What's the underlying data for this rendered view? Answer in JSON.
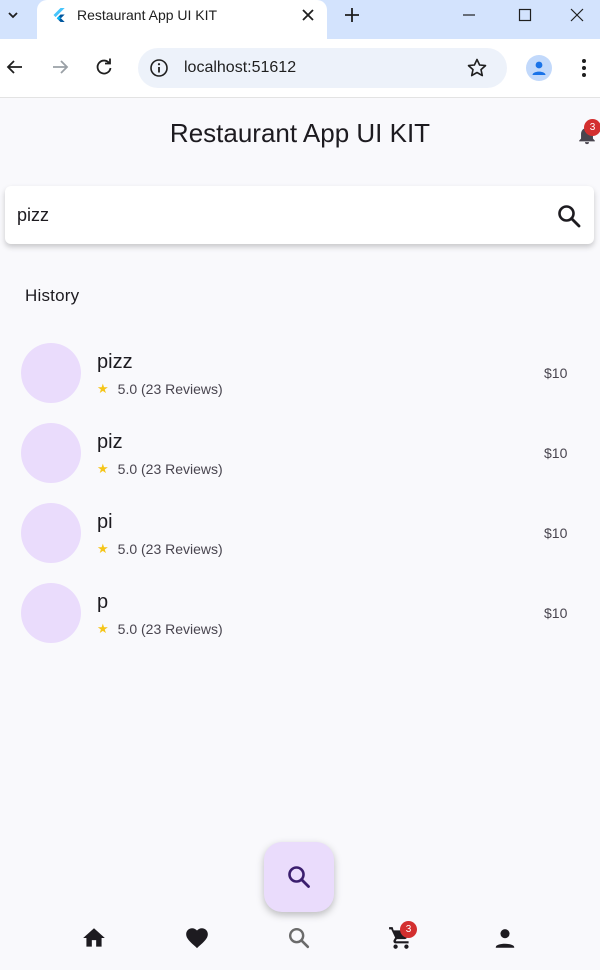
{
  "browser": {
    "tab_title": "Restaurant App UI KIT",
    "url": "localhost:51612",
    "icons": [
      "tab-list-icon",
      "flutter-icon",
      "close-icon",
      "plus-icon",
      "minimize-icon",
      "maximize-icon",
      "window-close-icon",
      "back-icon",
      "forward-icon",
      "reload-icon",
      "site-info-icon",
      "bookmark-star-icon",
      "profile-icon",
      "kebab-menu-icon"
    ]
  },
  "app": {
    "title": "Restaurant App UI KIT",
    "notification_count": "3",
    "search": {
      "value": "pizz"
    },
    "history_title": "History",
    "history": [
      {
        "name": "pizz",
        "rating": "5.0 (23 Reviews)",
        "price": "$10"
      },
      {
        "name": "piz",
        "rating": "5.0 (23 Reviews)",
        "price": "$10"
      },
      {
        "name": "pi",
        "rating": "5.0 (23 Reviews)",
        "price": "$10"
      },
      {
        "name": "p",
        "rating": "5.0 (23 Reviews)",
        "price": "$10"
      }
    ],
    "cart_count": "3",
    "bottom_nav": [
      "home-icon",
      "favorite-icon",
      "search-icon",
      "cart-icon",
      "person-icon"
    ]
  },
  "colors": {
    "accent": "#eadcfc",
    "fab_icon": "#3b1e6e",
    "star": "#f5c518",
    "badge": "#d32f2f",
    "tabbar": "#d3e3fd"
  }
}
